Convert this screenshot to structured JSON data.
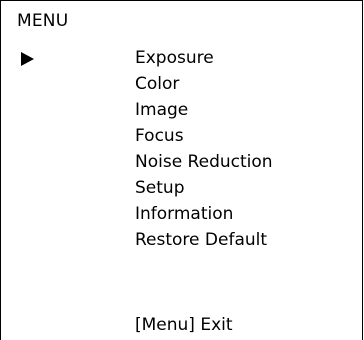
{
  "menu": {
    "title": "MENU",
    "cursor_icon": "triangle-right",
    "selected_index": 0,
    "items": [
      {
        "label": "Exposure"
      },
      {
        "label": "Color"
      },
      {
        "label": "Image"
      },
      {
        "label": "Focus"
      },
      {
        "label": "Noise Reduction"
      },
      {
        "label": "Setup"
      },
      {
        "label": "Information"
      },
      {
        "label": "Restore Default"
      }
    ],
    "exit_hint": "[Menu] Exit"
  }
}
